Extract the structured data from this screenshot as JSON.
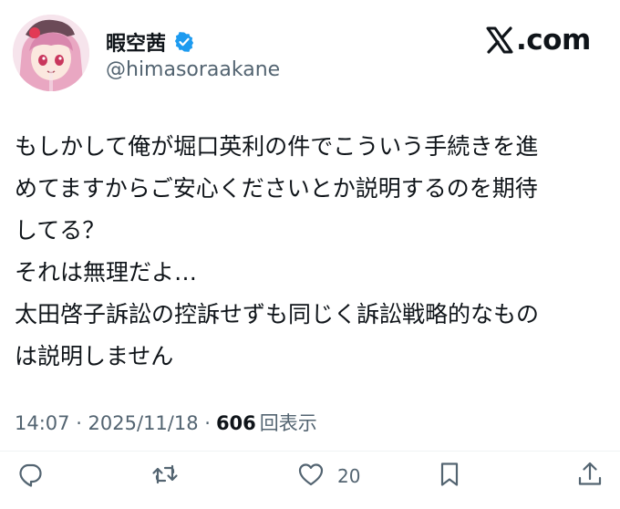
{
  "header": {
    "display_name": "暇空茜",
    "handle": "@himasoraakane",
    "site_label": ".com",
    "verified_icon": "verified-badge-icon",
    "x_logo_icon": "x-logo-icon"
  },
  "tweet": {
    "lines": [
      "もしかして俺が堀口英利の件でこういう手続きを進",
      "めてますからご安心くださいとか説明するのを期待",
      "してる？",
      "それは無理だよ…",
      "太田啓子訴訟の控訴せずも同じく訴訟戦略的なもの",
      "は説明しません"
    ]
  },
  "meta": {
    "timestamp": "14:07 · 2025/11/18 ·",
    "views": "606",
    "views_label": "回表示"
  },
  "actions": {
    "reply_icon": "reply-icon",
    "retweet_icon": "retweet-icon",
    "like_icon": "heart-icon",
    "like_count": "20",
    "bookmark_icon": "bookmark-icon",
    "share_icon": "share-icon"
  },
  "colors": {
    "text": "#0f1419",
    "secondary": "#536471",
    "verified": "#1d9bf0"
  }
}
